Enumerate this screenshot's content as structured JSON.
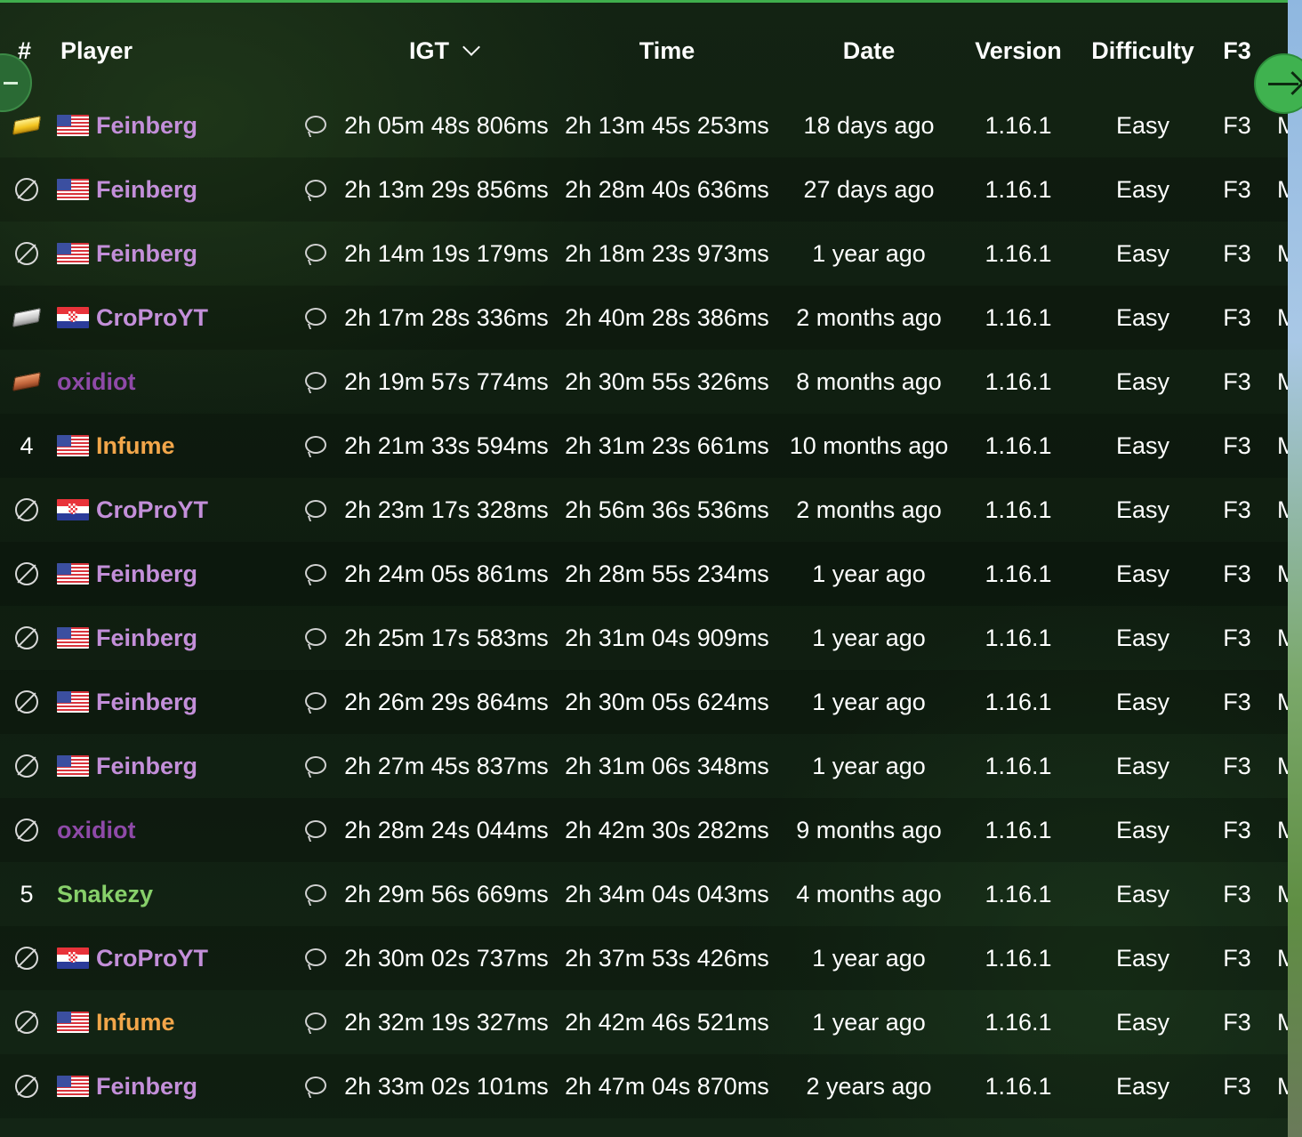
{
  "header": {
    "rank": "#",
    "player": "Player",
    "igt": "IGT",
    "time": "Time",
    "date": "Date",
    "version": "Version",
    "difficulty": "Difficulty",
    "f3": "F3"
  },
  "colors": {
    "accent": "#3fae4d",
    "player_feinberg": "#c38fd9",
    "player_croproyt": "#c38fd9",
    "player_oxidiot": "#8e4aa8",
    "player_infume": "#f2a64a",
    "player_snakezy": "#87d06a"
  },
  "icons": {
    "first_place": "gold-ingot-icon",
    "second_place": "iron-ingot-icon",
    "third_place": "brick-icon",
    "obsolete": "no-symbol-icon",
    "comment": "speech-bubble-icon",
    "sort": "chevron-down-icon",
    "next": "arrow-right-icon",
    "prev": "arrow-left-icon"
  },
  "rows": [
    {
      "rank": "",
      "medal": "gold",
      "flag": "us",
      "player": "Feinberg",
      "color": "#c38fd9",
      "igt": "2h 05m 48s 806ms",
      "time": "2h 13m 45s 253ms",
      "date": "18 days ago",
      "version": "1.16.1",
      "difficulty": "Easy",
      "f3": "F3",
      "extra": "M"
    },
    {
      "rank": "",
      "medal": "none",
      "flag": "us",
      "player": "Feinberg",
      "color": "#c38fd9",
      "igt": "2h 13m 29s 856ms",
      "time": "2h 28m 40s 636ms",
      "date": "27 days ago",
      "version": "1.16.1",
      "difficulty": "Easy",
      "f3": "F3",
      "extra": "M"
    },
    {
      "rank": "",
      "medal": "none",
      "flag": "us",
      "player": "Feinberg",
      "color": "#c38fd9",
      "igt": "2h 14m 19s 179ms",
      "time": "2h 18m 23s 973ms",
      "date": "1 year ago",
      "version": "1.16.1",
      "difficulty": "Easy",
      "f3": "F3",
      "extra": "M"
    },
    {
      "rank": "",
      "medal": "silver",
      "flag": "hr",
      "player": "CroProYT",
      "color": "#c38fd9",
      "igt": "2h 17m 28s 336ms",
      "time": "2h 40m 28s 386ms",
      "date": "2 months ago",
      "version": "1.16.1",
      "difficulty": "Easy",
      "f3": "F3",
      "extra": "M"
    },
    {
      "rank": "",
      "medal": "bronze",
      "flag": "",
      "player": "oxidiot",
      "color": "#8e4aa8",
      "igt": "2h 19m 57s 774ms",
      "time": "2h 30m 55s 326ms",
      "date": "8 months ago",
      "version": "1.16.1",
      "difficulty": "Easy",
      "f3": "F3",
      "extra": "M"
    },
    {
      "rank": "4",
      "medal": "",
      "flag": "us",
      "player": "Infume",
      "color": "#f2a64a",
      "igt": "2h 21m 33s 594ms",
      "time": "2h 31m 23s 661ms",
      "date": "10 months ago",
      "version": "1.16.1",
      "difficulty": "Easy",
      "f3": "F3",
      "extra": "M"
    },
    {
      "rank": "",
      "medal": "none",
      "flag": "hr",
      "player": "CroProYT",
      "color": "#c38fd9",
      "igt": "2h 23m 17s 328ms",
      "time": "2h 56m 36s 536ms",
      "date": "2 months ago",
      "version": "1.16.1",
      "difficulty": "Easy",
      "f3": "F3",
      "extra": "M"
    },
    {
      "rank": "",
      "medal": "none",
      "flag": "us",
      "player": "Feinberg",
      "color": "#c38fd9",
      "igt": "2h 24m 05s 861ms",
      "time": "2h 28m 55s 234ms",
      "date": "1 year ago",
      "version": "1.16.1",
      "difficulty": "Easy",
      "f3": "F3",
      "extra": "M"
    },
    {
      "rank": "",
      "medal": "none",
      "flag": "us",
      "player": "Feinberg",
      "color": "#c38fd9",
      "igt": "2h 25m 17s 583ms",
      "time": "2h 31m 04s 909ms",
      "date": "1 year ago",
      "version": "1.16.1",
      "difficulty": "Easy",
      "f3": "F3",
      "extra": "M"
    },
    {
      "rank": "",
      "medal": "none",
      "flag": "us",
      "player": "Feinberg",
      "color": "#c38fd9",
      "igt": "2h 26m 29s 864ms",
      "time": "2h 30m 05s 624ms",
      "date": "1 year ago",
      "version": "1.16.1",
      "difficulty": "Easy",
      "f3": "F3",
      "extra": "M"
    },
    {
      "rank": "",
      "medal": "none",
      "flag": "us",
      "player": "Feinberg",
      "color": "#c38fd9",
      "igt": "2h 27m 45s 837ms",
      "time": "2h 31m 06s 348ms",
      "date": "1 year ago",
      "version": "1.16.1",
      "difficulty": "Easy",
      "f3": "F3",
      "extra": "M"
    },
    {
      "rank": "",
      "medal": "none",
      "flag": "",
      "player": "oxidiot",
      "color": "#8e4aa8",
      "igt": "2h 28m 24s 044ms",
      "time": "2h 42m 30s 282ms",
      "date": "9 months ago",
      "version": "1.16.1",
      "difficulty": "Easy",
      "f3": "F3",
      "extra": "M"
    },
    {
      "rank": "5",
      "medal": "",
      "flag": "",
      "player": "Snakezy",
      "color": "#87d06a",
      "igt": "2h 29m 56s 669ms",
      "time": "2h 34m 04s 043ms",
      "date": "4 months ago",
      "version": "1.16.1",
      "difficulty": "Easy",
      "f3": "F3",
      "extra": "M"
    },
    {
      "rank": "",
      "medal": "none",
      "flag": "hr",
      "player": "CroProYT",
      "color": "#c38fd9",
      "igt": "2h 30m 02s 737ms",
      "time": "2h 37m 53s 426ms",
      "date": "1 year ago",
      "version": "1.16.1",
      "difficulty": "Easy",
      "f3": "F3",
      "extra": "M"
    },
    {
      "rank": "",
      "medal": "none",
      "flag": "us",
      "player": "Infume",
      "color": "#f2a64a",
      "igt": "2h 32m 19s 327ms",
      "time": "2h 42m 46s 521ms",
      "date": "1 year ago",
      "version": "1.16.1",
      "difficulty": "Easy",
      "f3": "F3",
      "extra": "M"
    },
    {
      "rank": "",
      "medal": "none",
      "flag": "us",
      "player": "Feinberg",
      "color": "#c38fd9",
      "igt": "2h 33m 02s 101ms",
      "time": "2h 47m 04s 870ms",
      "date": "2 years ago",
      "version": "1.16.1",
      "difficulty": "Easy",
      "f3": "F3",
      "extra": "M"
    }
  ]
}
